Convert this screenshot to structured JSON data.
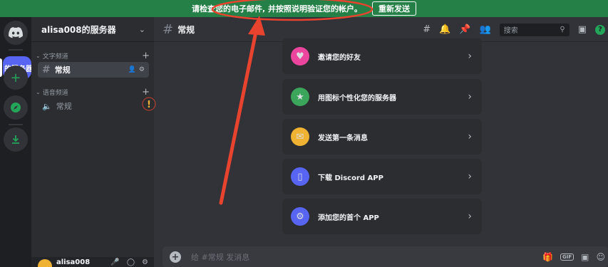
{
  "notice": {
    "text": "请检查您的电子邮件, 并按照说明验证您的帐户。",
    "button": "重新发送"
  },
  "rail": {
    "active_server_label": "的服务器",
    "icons": [
      "discord-logo-icon",
      "add-server-icon",
      "explore-icon",
      "download-icon"
    ]
  },
  "server": {
    "name": "alisa008的服务器",
    "categories": [
      {
        "name": "文字频道",
        "channels": [
          {
            "name": "常规",
            "type": "text"
          }
        ]
      },
      {
        "name": "语音频道",
        "channels": [
          {
            "name": "常规",
            "type": "voice"
          }
        ]
      }
    ]
  },
  "user": {
    "name": "alisa008"
  },
  "channel": {
    "title": "常规"
  },
  "header": {
    "search_placeholder": "搜索"
  },
  "cards": [
    {
      "label": "邀请您的好友",
      "icon": "invite-friends-icon",
      "color": "#eb459e"
    },
    {
      "label": "用图标个性化您的服务器",
      "icon": "personalize-icon",
      "color": "#3ba55c"
    },
    {
      "label": "发送第一条消息",
      "icon": "message-icon",
      "color": "#f0b232"
    },
    {
      "label": "下载 Discord APP",
      "icon": "download-app-icon",
      "color": "#5865f2"
    },
    {
      "label": "添加您的首个 APP",
      "icon": "add-app-icon",
      "color": "#5865f2"
    }
  ],
  "composer": {
    "placeholder": "给 #常规 发消息"
  },
  "colors": {
    "notice_bg": "#248046",
    "accent": "#5865f2",
    "annotation": "#e8432e"
  }
}
